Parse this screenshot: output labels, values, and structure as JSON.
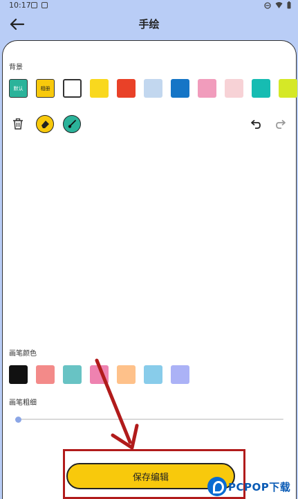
{
  "status_bar": {
    "time": "10:17"
  },
  "header": {
    "title": "手绘"
  },
  "background_section": {
    "label": "背景",
    "default_chip": "默认",
    "album_chip": "相册",
    "colors": [
      "#ffffff",
      "#f9d81e",
      "#e94128",
      "#c2d7ef",
      "#1575c6",
      "#f19cbc",
      "#f7d2d6",
      "#16bcb2",
      "#d5e827"
    ]
  },
  "pen_color_section": {
    "label": "画笔颜色",
    "colors": [
      "#111111",
      "#f38a89",
      "#68c3c4",
      "#ee82b0",
      "#fec18a",
      "#88ccea",
      "#abb2f6"
    ]
  },
  "pen_width_section": {
    "label": "画笔粗细",
    "value": 0.0
  },
  "save_button": {
    "label": "保存编辑"
  },
  "watermark": {
    "text": "PCPOP下载"
  }
}
